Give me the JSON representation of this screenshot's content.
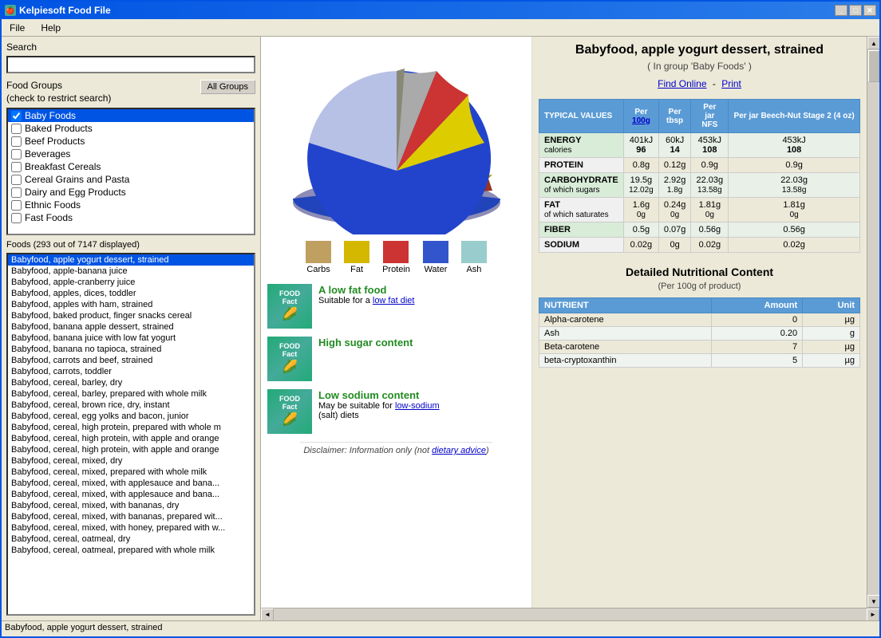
{
  "window": {
    "title": "Kelpiesoft Food File",
    "icon": "🍎"
  },
  "menu": {
    "items": [
      "File",
      "Help"
    ]
  },
  "search": {
    "label": "Search",
    "placeholder": "",
    "value": ""
  },
  "food_groups": {
    "label": "Food Groups",
    "sublabel": "(check to restrict search)",
    "all_groups_btn": "All Groups",
    "items": [
      {
        "label": "Baby Foods",
        "checked": true,
        "selected": true
      },
      {
        "label": "Baked Products",
        "checked": false,
        "selected": false
      },
      {
        "label": "Beef Products",
        "checked": false,
        "selected": false
      },
      {
        "label": "Beverages",
        "checked": false,
        "selected": false
      },
      {
        "label": "Breakfast Cereals",
        "checked": false,
        "selected": false
      },
      {
        "label": "Cereal Grains and Pasta",
        "checked": false,
        "selected": false
      },
      {
        "label": "Dairy and Egg Products",
        "checked": false,
        "selected": false
      },
      {
        "label": "Ethnic Foods",
        "checked": false,
        "selected": false
      },
      {
        "label": "Fast Foods",
        "checked": false,
        "selected": false
      }
    ]
  },
  "foods_count": "Foods (293 out of 7147 displayed)",
  "foods_list": [
    {
      "label": "Babyfood, apple yogurt dessert, strained",
      "selected": true
    },
    {
      "label": "Babyfood, apple-banana juice"
    },
    {
      "label": "Babyfood, apple-cranberry juice"
    },
    {
      "label": "Babyfood, apples, dices, toddler"
    },
    {
      "label": "Babyfood, apples with ham, strained"
    },
    {
      "label": "Babyfood, baked product, finger snacks cereal"
    },
    {
      "label": "Babyfood, banana apple dessert, strained"
    },
    {
      "label": "Babyfood, banana juice with low fat yogurt"
    },
    {
      "label": "Babyfood, banana no tapioca, strained"
    },
    {
      "label": "Babyfood, carrots and beef, strained"
    },
    {
      "label": "Babyfood, carrots, toddler"
    },
    {
      "label": "Babyfood, cereal, barley, dry"
    },
    {
      "label": "Babyfood, cereal, barley, prepared with whole milk"
    },
    {
      "label": "Babyfood, cereal, brown rice, dry, instant"
    },
    {
      "label": "Babyfood, cereal, egg yolks and bacon, junior"
    },
    {
      "label": "Babyfood, cereal, high protein, prepared with whole m"
    },
    {
      "label": "Babyfood, cereal, high protein, with apple and orange"
    },
    {
      "label": "Babyfood, cereal, high protein, with apple and orange"
    },
    {
      "label": "Babyfood, cereal, mixed, dry"
    },
    {
      "label": "Babyfood, cereal, mixed, prepared with whole milk"
    },
    {
      "label": "Babyfood, cereal, mixed, with applesauce and bana..."
    },
    {
      "label": "Babyfood, cereal, mixed, with applesauce and bana..."
    },
    {
      "label": "Babyfood, cereal, mixed, with bananas, dry"
    },
    {
      "label": "Babyfood, cereal, mixed, with bananas, prepared wit..."
    },
    {
      "label": "Babyfood, cereal, mixed, with honey, prepared with w..."
    },
    {
      "label": "Babyfood, cereal, oatmeal, dry"
    },
    {
      "label": "Babyfood, cereal, oatmeal, prepared with whole milk"
    }
  ],
  "status_bar": "Babyfood, apple yogurt dessert, strained",
  "food_detail": {
    "title": "Babyfood, apple yogurt dessert, strained",
    "group": "( In group 'Baby Foods' )",
    "find_online": "Find Online",
    "print": "Print",
    "nutrition": {
      "headers": [
        "TYPICAL VALUES",
        "Per 100g",
        "Per tbsp",
        "Per jar NFS",
        "Per jar Beech-Nut Stage 2 (4 oz)"
      ],
      "rows": [
        {
          "label": "ENERGY",
          "sublabel": "calories",
          "shaded": true,
          "values": [
            "401kJ",
            "60kJ",
            "453kJ",
            "453kJ"
          ],
          "subvalues": [
            "96",
            "14",
            "108",
            "108"
          ]
        },
        {
          "label": "PROTEIN",
          "shaded": false,
          "values": [
            "0.8g",
            "0.12g",
            "0.9g",
            "0.9g"
          ]
        },
        {
          "label": "CARBOHYDRATE",
          "sublabel": "of which sugars",
          "shaded": true,
          "values": [
            "19.5g",
            "2.92g",
            "22.03g",
            "22.03g"
          ],
          "subvalues": [
            "12.02g",
            "1.8g",
            "13.58g",
            "13.58g"
          ]
        },
        {
          "label": "FAT",
          "sublabel": "of which saturates",
          "shaded": false,
          "values": [
            "1.6g",
            "0.24g",
            "1.81g",
            "1.81g"
          ],
          "subvalues": [
            "0g",
            "0g",
            "0g",
            "0g"
          ]
        },
        {
          "label": "FIBER",
          "shaded": true,
          "values": [
            "0.5g",
            "0.07g",
            "0.56g",
            "0.56g"
          ]
        },
        {
          "label": "SODIUM",
          "shaded": false,
          "values": [
            "0.02g",
            "0g",
            "0.02g",
            "0.02g"
          ]
        }
      ]
    },
    "detailed": {
      "title": "Detailed Nutritional Content",
      "subtitle": "(Per 100g of product)",
      "headers": [
        "NUTRIENT",
        "Amount",
        "Unit"
      ],
      "rows": [
        {
          "nutrient": "Alpha-carotene",
          "amount": "0",
          "unit": "µg"
        },
        {
          "nutrient": "Ash",
          "amount": "0.20",
          "unit": "g"
        },
        {
          "nutrient": "Beta-carotene",
          "amount": "7",
          "unit": "µg"
        },
        {
          "nutrient": "beta-cryptoxanthin",
          "amount": "5",
          "unit": "µg"
        }
      ]
    }
  },
  "legend": {
    "items": [
      {
        "label": "Carbs",
        "color": "#c0a060"
      },
      {
        "label": "Fat",
        "color": "#d4b800"
      },
      {
        "label": "Protein",
        "color": "#cc3333"
      },
      {
        "label": "Water",
        "color": "#3355cc"
      },
      {
        "label": "Ash",
        "color": "#99cccc"
      }
    ]
  },
  "food_facts": [
    {
      "title": "A low fat food",
      "sub": "Suitable for a ",
      "link_text": "low fat diet",
      "link": "#"
    },
    {
      "title": "High sugar content",
      "sub": "",
      "link_text": "",
      "link": ""
    },
    {
      "title": "Low sodium content",
      "sub": "May be suitable for ",
      "link_text": "low-sodium",
      "sub2": "(salt) diets",
      "link": "#"
    }
  ],
  "disclaimer": "Disclaimer: Information only (not ",
  "disclaimer_link": "dietary advice",
  "disclaimer_end": ")"
}
